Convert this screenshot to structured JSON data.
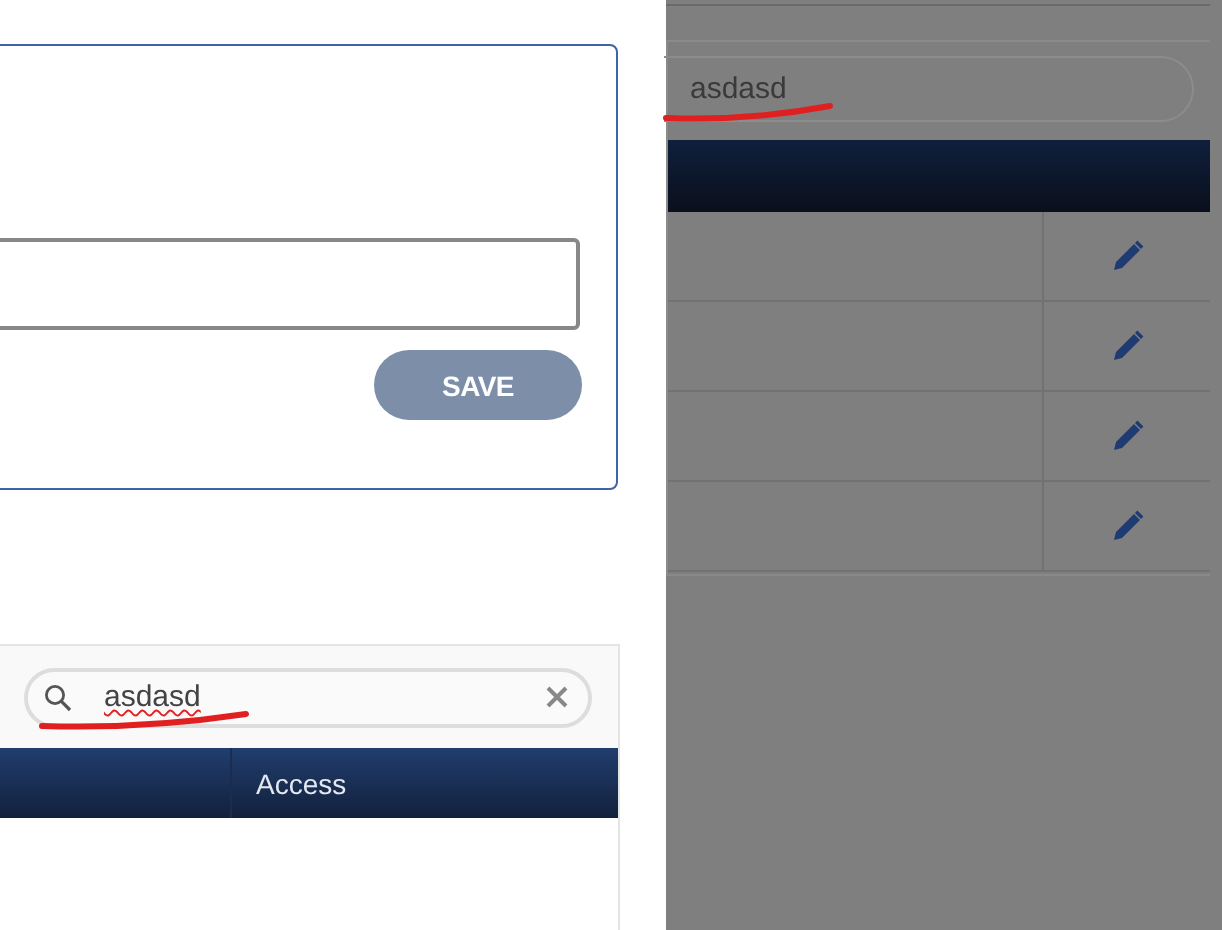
{
  "form": {
    "save_button": {
      "label": "SAVE",
      "disabled": true
    }
  },
  "access_list": {
    "search": {
      "value": "asdasd",
      "spelling_error": true
    },
    "columns": [
      {
        "label": "Access"
      }
    ]
  },
  "background_table": {
    "search": {
      "value": "asdasd"
    },
    "rows": [
      {
        "editable": true
      },
      {
        "editable": true
      },
      {
        "editable": true
      },
      {
        "editable": true
      }
    ]
  },
  "annotations": [
    {
      "kind": "underline",
      "color": "#e02020"
    },
    {
      "kind": "underline",
      "color": "#e02020"
    }
  ]
}
